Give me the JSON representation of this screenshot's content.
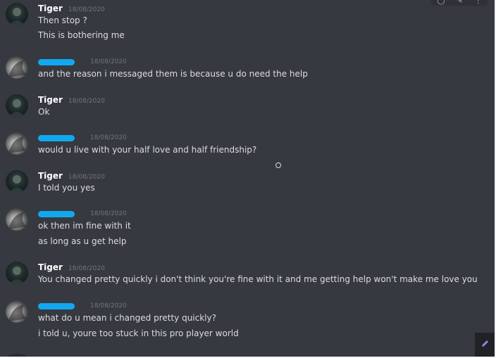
{
  "messages": [
    {
      "author": "Tiger",
      "timestamp": "18/08/2020",
      "lines": [
        "Then stop ?",
        "This is bothering me"
      ]
    },
    {
      "author": "",
      "timestamp": "18/08/2020",
      "lines": [
        "and the reason i messaged them is because u do need the help"
      ]
    },
    {
      "author": "Tiger",
      "timestamp": "18/08/2020",
      "lines": [
        "Ok"
      ]
    },
    {
      "author": "",
      "timestamp": "18/08/2020",
      "lines": [
        "would u live with your half love and half friendship?"
      ]
    },
    {
      "author": "Tiger",
      "timestamp": "18/08/2020",
      "lines": [
        "I told you yes"
      ]
    },
    {
      "author": "",
      "timestamp": "18/08/2020",
      "lines": [
        "ok then im fine with it",
        "as long as u get help"
      ]
    },
    {
      "author": "Tiger",
      "timestamp": "18/08/2020",
      "lines": [
        "You changed pretty quickly i don't think you're fine with it and me getting help won't make me love you"
      ]
    },
    {
      "author": "",
      "timestamp": "18/08/2020",
      "lines": [
        "what do u mean i changed pretty quickly?",
        "i told u, youre too stuck in this pro player world"
      ]
    }
  ],
  "colors": {
    "background": "#36393f",
    "text": "#dcddde",
    "username": "#ffffff",
    "timestamp": "#72767d",
    "redaction": "#12a8f0"
  },
  "icons": {
    "toolbar": [
      "reaction-icon",
      "edit-icon",
      "more-icon"
    ],
    "corner": "pencil-icon"
  }
}
